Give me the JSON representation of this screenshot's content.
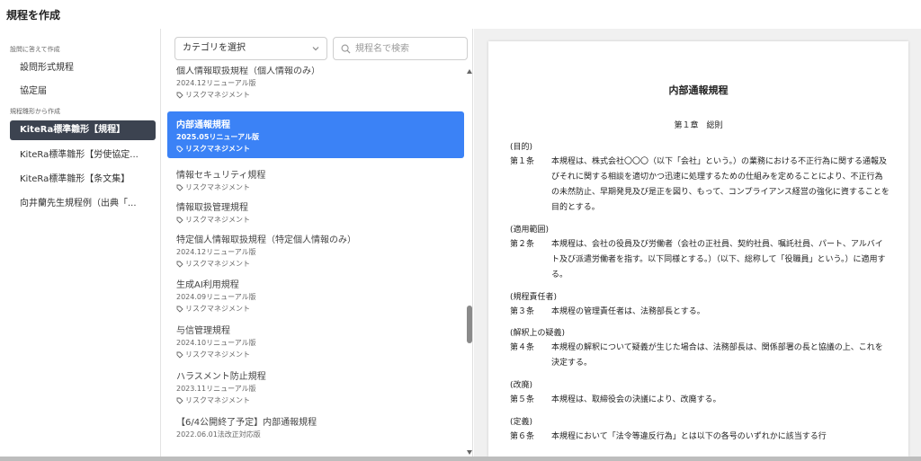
{
  "header": {
    "title": "規程を作成"
  },
  "sidebar": {
    "sections": [
      {
        "label": "設問に答えて作成",
        "items": [
          {
            "label": "設問形式規程"
          },
          {
            "label": "協定届"
          }
        ]
      },
      {
        "label": "規程雛形から作成",
        "items": [
          {
            "label": "KiteRa標準雛形【規程】",
            "active": true
          },
          {
            "label": "KiteRa標準雛形【労使協定..."
          },
          {
            "label": "KiteRa標準雛形【条文集】"
          },
          {
            "label": "向井蘭先生規程例（出典「..."
          }
        ]
      }
    ]
  },
  "filters": {
    "category_label": "カテゴリを選択",
    "search_placeholder": "規程名で検索"
  },
  "list": {
    "items": [
      {
        "name": "個人情報取扱規程（個人情報のみ）",
        "meta": "2024.12リニューアル版",
        "tag": ""
      },
      {
        "name": "内部通報規程",
        "meta": "2025.05リニューアル版",
        "tag": "リスクマネジメント",
        "selected": true
      },
      {
        "name": "情報セキュリティ規程",
        "meta": "",
        "tag": "リスクマネジメント"
      },
      {
        "name": "情報取扱管理規程",
        "meta": "",
        "tag": "リスクマネジメント"
      },
      {
        "name": "特定個人情報取扱規程（特定個人情報のみ）",
        "meta": "2024.12リニューアル版",
        "tag": "リスクマネジメント"
      },
      {
        "name": "生成AI利用規程",
        "meta": "2024.09リニューアル版",
        "tag": "リスクマネジメント"
      },
      {
        "name": "与信管理規程",
        "meta": "2024.10リニューアル版",
        "tag": "リスクマネジメント"
      },
      {
        "name": "ハラスメント防止規程",
        "meta": "2023.11リニューアル版",
        "tag": "リスクマネジメント"
      },
      {
        "name": "【6/4公開終了予定】内部通報規程",
        "meta": "2022.06.01法改正対応版",
        "tag": ""
      }
    ],
    "first_item_tag": "リスクマネジメント"
  },
  "document": {
    "title": "内部通報規程",
    "chapter": "第１章　総則",
    "sections": [
      {
        "heading": "(目的)",
        "num": "第１条",
        "body": "本規程は、株式会社〇〇〇（以下「会社」という。）の業務における不正行為に関する通報及びそれに関する相談を適切かつ迅速に処理するための仕組みを定めることにより、不正行為の未然防止、早期発見及び是正を図り、もって、コンプライアンス経営の強化に資することを目的とする。"
      },
      {
        "heading": "(適用範囲)",
        "num": "第２条",
        "body": "本規程は、会社の役員及び労働者（会社の正社員、契約社員、嘱託社員、パート、アルバイト及び派遣労働者を指す。以下同様とする。）（以下、総称して「役職員」という。）に適用する。"
      },
      {
        "heading": "(規程責任者)",
        "num": "第３条",
        "body": "本規程の管理責任者は、法務部長とする。"
      },
      {
        "heading": "(解釈上の疑義)",
        "num": "第４条",
        "body": "本規程の解釈について疑義が生じた場合は、法務部長は、関係部署の長と協議の上、これを決定する。"
      },
      {
        "heading": "(改廃)",
        "num": "第５条",
        "body": "本規程は、取締役会の決議により、改廃する。"
      },
      {
        "heading": "(定義)",
        "num": "第６条",
        "body": "本規程において「法令等違反行為」とは以下の各号のいずれかに該当する行"
      }
    ]
  },
  "colors": {
    "selected": "#3b82f6",
    "active_nav": "#3c4350"
  },
  "icons": {
    "category_chevron": "chevron-down-icon",
    "search": "search-icon",
    "tag": "tag-icon"
  }
}
